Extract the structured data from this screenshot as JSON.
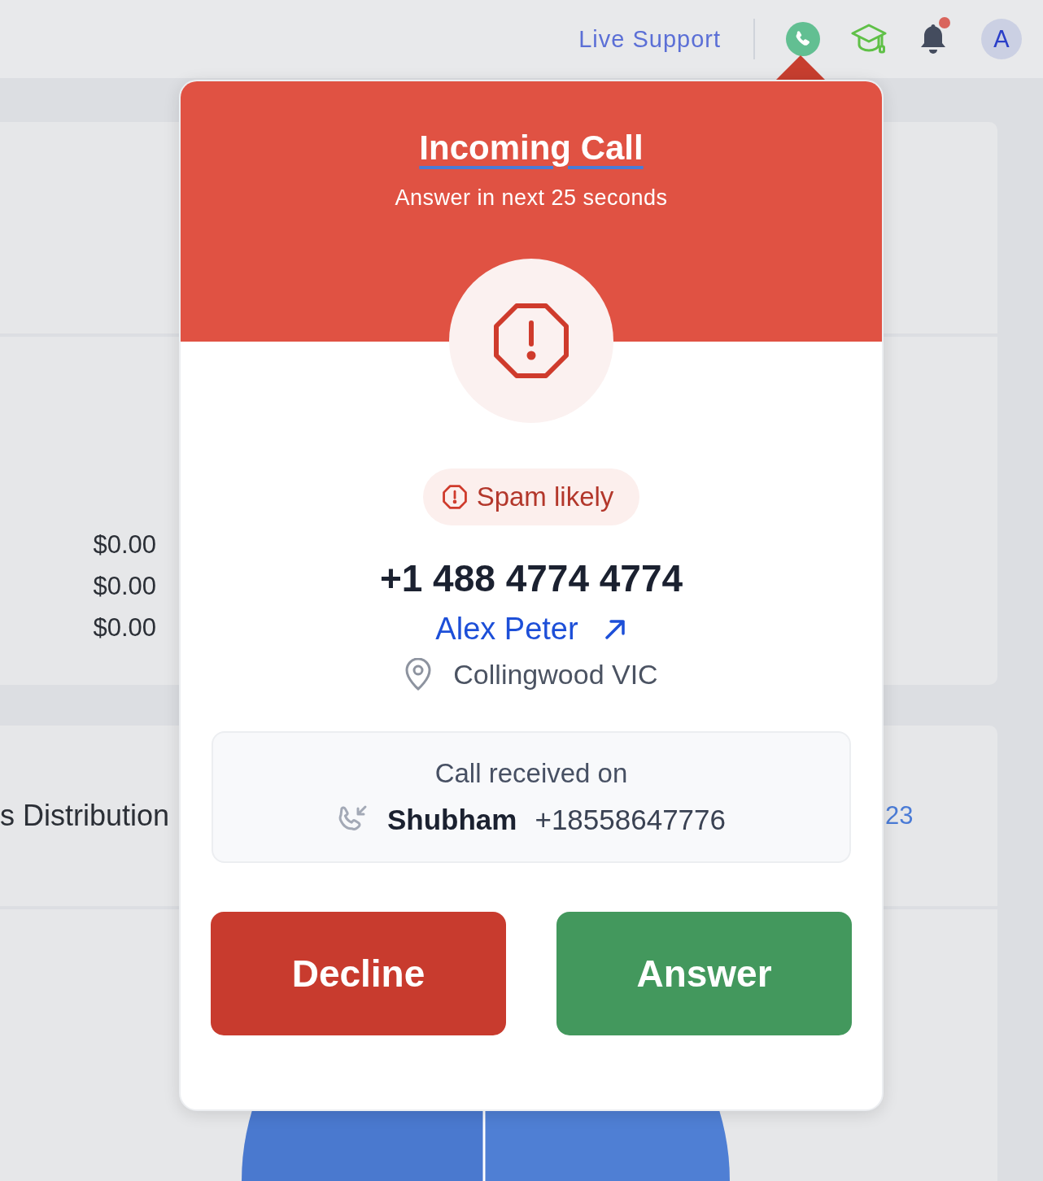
{
  "top_bar": {
    "live_support": "Live Support",
    "avatar": "A",
    "notifications": {
      "unread": true
    }
  },
  "background": {
    "amounts": [
      "$0.00",
      "$0.00",
      "$0.00"
    ],
    "section_title": "s Distribution",
    "side_value": "23"
  },
  "incoming_call": {
    "title": "Incoming Call",
    "subtitle": "Answer in next 25 seconds",
    "badge": "Spam likely",
    "caller_number": "+1 488 4774 4774",
    "contact_name": "Alex Peter",
    "location": "Collingwood VIC",
    "received_label": "Call received on",
    "line_name": "Shubham",
    "line_number": "+18558647776",
    "buttons": [
      {
        "label": "Decline",
        "kind": "decline"
      },
      {
        "label": "Answer",
        "kind": "answer"
      }
    ]
  }
}
